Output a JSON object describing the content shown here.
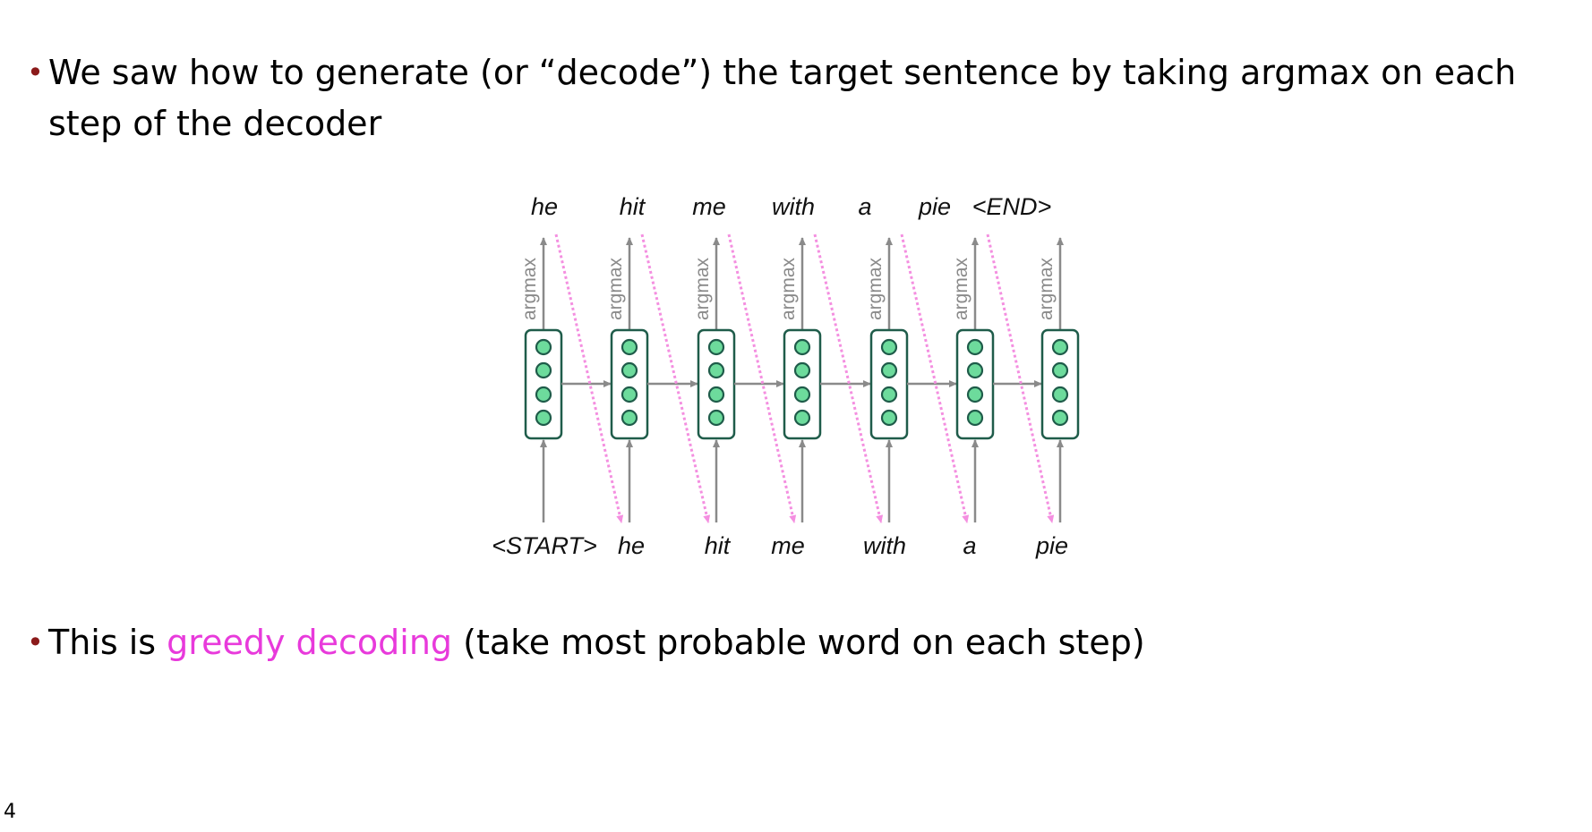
{
  "bullets": [
    {
      "segments": [
        {
          "text": "We saw how to generate (or “decode”) the target sentence by taking argmax on each\nstep of the decoder",
          "highlight": false
        }
      ]
    },
    {
      "segments": [
        {
          "text": "This is ",
          "highlight": false
        },
        {
          "text": "greedy decoding",
          "highlight": true
        },
        {
          "text": " (take most probable word on each step)",
          "highlight": false
        }
      ]
    }
  ],
  "bullet_marker": "•",
  "diagram": {
    "output_words": [
      "he",
      "hit",
      "me",
      "with",
      "a",
      "pie",
      "<END>"
    ],
    "input_words": [
      "<START>",
      "he",
      "hit",
      "me",
      "with",
      "a",
      "pie"
    ],
    "argmax_label": "argmax",
    "neurons_per_cell": 4
  },
  "page_number": "4",
  "colors": {
    "bullet_marker": "#8B1A1A",
    "highlight": "#E83ADB",
    "cell_border": "#1F5C4A",
    "neuron_fill": "#6DDB9C",
    "arrow": "#8a8a8a",
    "feedback_arrow": "#F48FE0"
  }
}
